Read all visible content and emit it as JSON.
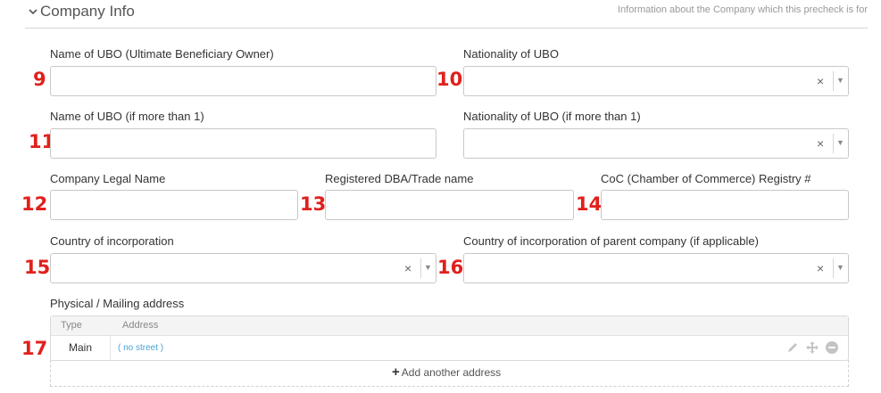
{
  "section": {
    "title": "Company Info",
    "description": "Information about the Company which this precheck is for"
  },
  "fields": {
    "ubo_name": {
      "label": "Name of UBO (Ultimate Beneficiary Owner)",
      "value": "",
      "marker": "9"
    },
    "ubo_nationality": {
      "label": "Nationality of UBO",
      "value": "",
      "marker": "10"
    },
    "ubo_name_2": {
      "label": "Name of UBO (if more than 1)",
      "value": "",
      "marker": "11"
    },
    "ubo_nationality_2": {
      "label": "Nationality of UBO (if more than 1)",
      "value": ""
    },
    "legal_name": {
      "label": "Company Legal Name",
      "value": "",
      "marker": "12"
    },
    "dba_name": {
      "label": "Registered DBA/Trade name",
      "value": "",
      "marker": "13"
    },
    "coc_registry": {
      "label": "CoC (Chamber of Commerce) Registry #",
      "value": "",
      "marker": "14"
    },
    "country_inc": {
      "label": "Country of incorporation",
      "value": "",
      "marker": "15"
    },
    "country_inc_parent": {
      "label": "Country of incorporation of parent company (if applicable)",
      "value": "",
      "marker": "16"
    }
  },
  "select_glyphs": {
    "clear": "×",
    "arrow": "▼"
  },
  "address": {
    "label": "Physical / Mailing address",
    "marker": "17",
    "columns": [
      "Type",
      "Address"
    ],
    "rows": [
      {
        "type": "Main",
        "address": "( no street )"
      }
    ],
    "row_icons": [
      "pencil-icon",
      "move-icon",
      "remove-icon"
    ],
    "add_label": "Add another address",
    "add_icon": "+"
  },
  "colors": {
    "marker": "#e0201c",
    "link": "#4aa3d8",
    "border": "#c8c8c8"
  }
}
